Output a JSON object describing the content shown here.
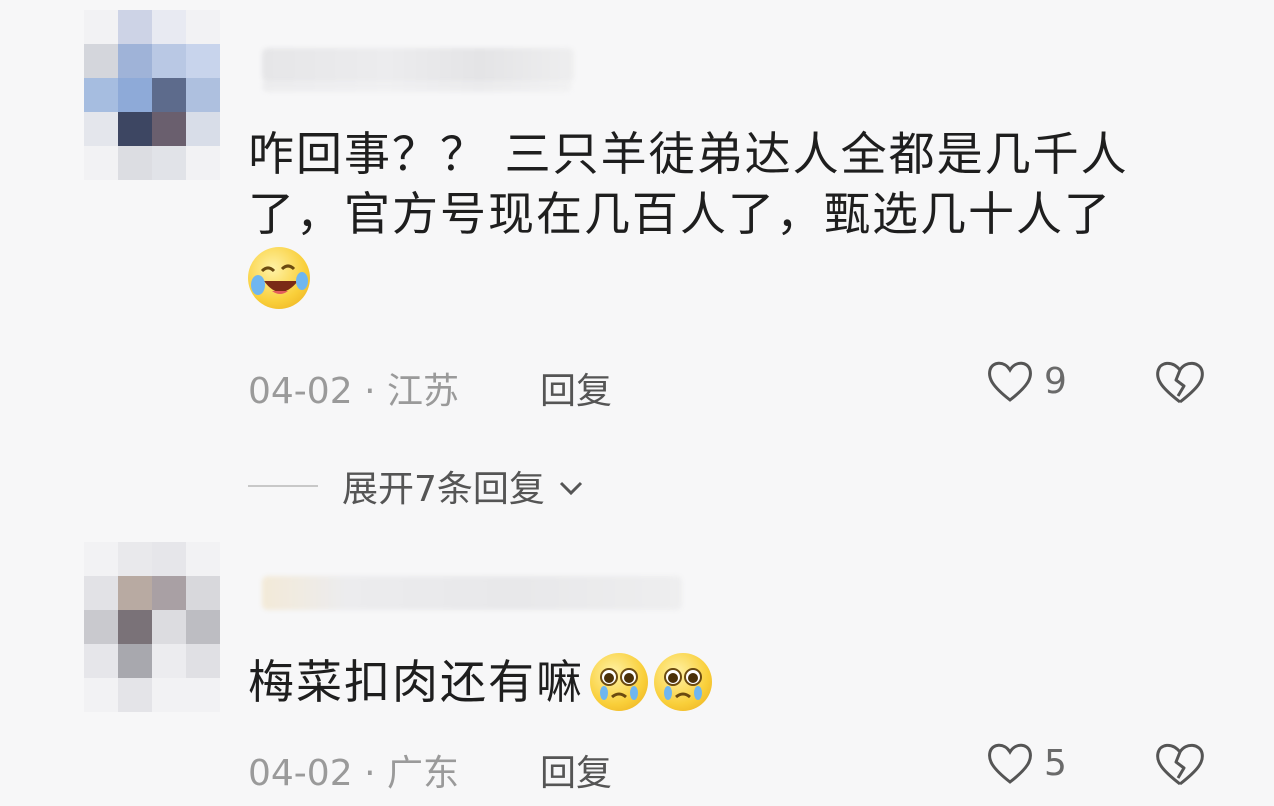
{
  "comments": [
    {
      "text_line1": "咋回事？？ 三只羊徒弟达人全都是几千人",
      "text_line2": "了，官方号现在几百人了，甄选几十人了",
      "emoji": "laugh-cry-emoji",
      "date": "04-02",
      "location": "江苏",
      "reply_label": "回复",
      "likes": "9"
    },
    {
      "text_line1": "梅菜扣肉还有嘛",
      "emoji": "pleading-emoji",
      "date": "04-02",
      "location": "广东",
      "reply_label": "回复",
      "likes": "5"
    }
  ],
  "expand_replies_label": "展开7条回复",
  "colors": {
    "background": "#f7f7f8",
    "meta": "#9a9a9a",
    "text": "#1e1e1e"
  }
}
